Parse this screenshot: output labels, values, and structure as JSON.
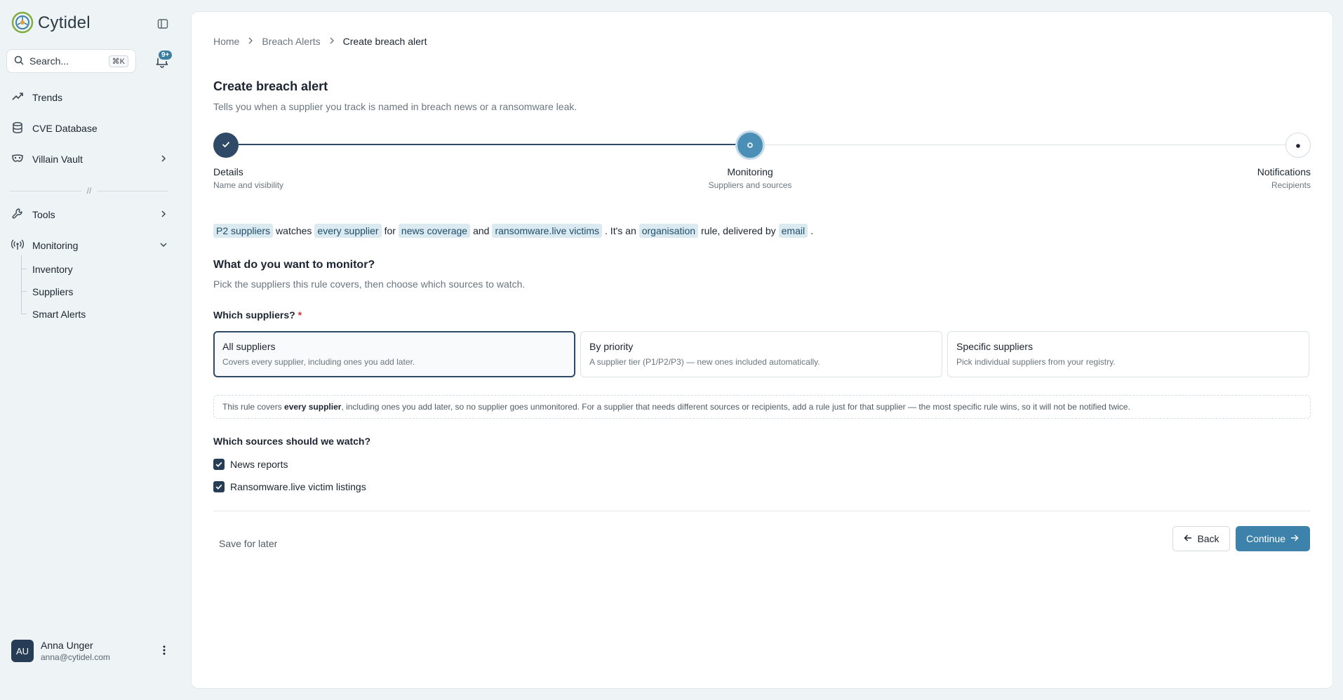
{
  "app": {
    "name": "Cytidel"
  },
  "search": {
    "placeholder": "Search...",
    "shortcut": "⌘K"
  },
  "notifications": {
    "badge": "9+"
  },
  "nav": {
    "trends": "Trends",
    "cve": "CVE Database",
    "villain": "Villain Vault",
    "divider": "//",
    "tools": "Tools",
    "monitoring": "Monitoring",
    "sub": [
      "Inventory",
      "Suppliers",
      "Smart Alerts"
    ]
  },
  "user": {
    "initials": "AU",
    "name": "Anna Unger",
    "email": "anna@cytidel.com"
  },
  "breadcrumb": [
    "Home",
    "Breach Alerts",
    "Create breach alert"
  ],
  "page": {
    "title": "Create breach alert",
    "subtitle": "Tells you when a supplier you track is named in breach news or a ransomware leak."
  },
  "steps": [
    {
      "title": "Details",
      "sub": "Name and visibility",
      "state": "done"
    },
    {
      "title": "Monitoring",
      "sub": "Suppliers and sources",
      "state": "current"
    },
    {
      "title": "Notifications",
      "sub": "Recipients",
      "state": "upcoming"
    }
  ],
  "summary": {
    "p1": "P2 suppliers",
    "t1": "watches",
    "p2": "every supplier",
    "t2": "for",
    "p3": "news coverage",
    "t3": "and",
    "p4": "ransomware.live victims",
    "t4": ". It's an",
    "p5": "organisation",
    "t5": "rule, delivered by",
    "p6": "email",
    "t6": "."
  },
  "monitor": {
    "heading": "What do you want to monitor?",
    "sub": "Pick the suppliers this rule covers, then choose which sources to watch.",
    "suppliers_label": "Which suppliers?",
    "required": "*",
    "options": [
      {
        "title": "All suppliers",
        "desc": "Covers every supplier, including ones you add later.",
        "selected": true
      },
      {
        "title": "By priority",
        "desc": "A supplier tier (P1/P2/P3) — new ones included automatically.",
        "selected": false
      },
      {
        "title": "Specific suppliers",
        "desc": "Pick individual suppliers from your registry.",
        "selected": false
      }
    ],
    "note_pre": "This rule covers ",
    "note_bold": "every supplier",
    "note_post": ", including ones you add later, so no supplier goes unmonitored. For a supplier that needs different sources or recipients, add a rule just for that supplier — the most specific rule wins, so it will not be notified twice.",
    "sources_label": "Which sources should we watch?",
    "sources": [
      {
        "label": "News reports",
        "checked": true
      },
      {
        "label": "Ransomware.live victim listings",
        "checked": true
      }
    ]
  },
  "footer": {
    "save_later": "Save for later",
    "back": "Back",
    "continue": "Continue"
  },
  "colors": {
    "accent": "#3c82aa",
    "navy": "#263d55",
    "pill_bg": "#dbe9f1",
    "page_bg": "#eef3f5"
  }
}
